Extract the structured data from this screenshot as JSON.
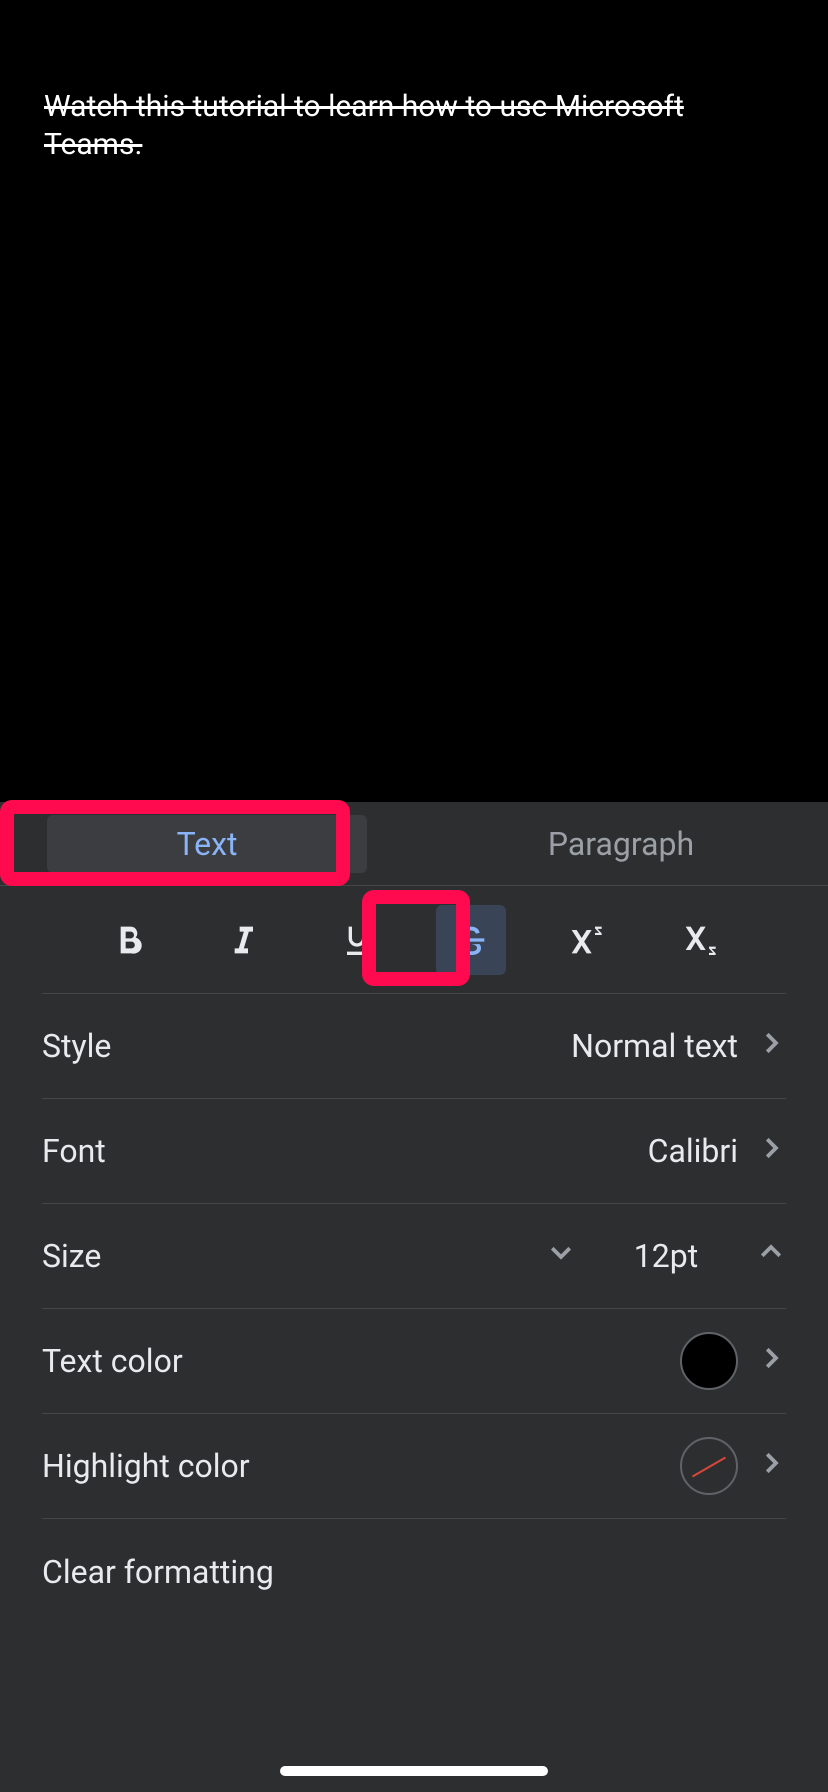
{
  "document": {
    "text": "Watch this tutorial to learn how to use Microsoft Teams."
  },
  "tabs": {
    "text": "Text",
    "paragraph": "Paragraph"
  },
  "rows": {
    "style": {
      "label": "Style",
      "value": "Normal text"
    },
    "font": {
      "label": "Font",
      "value": "Calibri"
    },
    "size": {
      "label": "Size",
      "value": "12pt"
    },
    "text_color": {
      "label": "Text color"
    },
    "highlight_color": {
      "label": "Highlight color"
    },
    "clear_formatting": {
      "label": "Clear formatting"
    }
  }
}
